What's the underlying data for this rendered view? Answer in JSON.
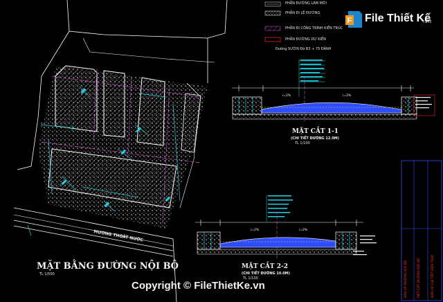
{
  "legend": {
    "items": [
      {
        "label": "PHẦN ĐƯỜNG LÀM MỚI",
        "swatch": "lines"
      },
      {
        "label": "PHẦN ĐI LÊ ĐƯỜNG",
        "swatch": "dots"
      },
      {
        "label": "PHẦN ĐI CÔNG TRÌNH KIẾN TRÚC",
        "swatch": "hatch"
      },
      {
        "label": "PHẦN ĐƯỜNG DỰ KIẾN",
        "swatch": "box"
      }
    ],
    "note": "Đường SƯỜN Độ B3 + 75 ĐÁNH"
  },
  "plan": {
    "title": "MẶT BẰNG ĐƯỜNG NỘI BỘ",
    "scale": "TL 1/500",
    "road_label": "MƯƠNG THOÁT NƯỚC"
  },
  "section1": {
    "title": "MẶT CẮT 1-1",
    "subtitle": "(CHI TIẾT ĐƯỜNG 12.0M)",
    "scale": "TL 1/100",
    "slope_left": "i=2%",
    "slope_right": "i=2%"
  },
  "section2": {
    "title": "MẶT CẮT 2-2",
    "subtitle": "(CHI TIẾT ĐƯỜNG 10.0M)",
    "scale": "TL 1/100",
    "slope_left": "i=2%",
    "slope_right": "i=2%"
  },
  "title_block": {
    "col1": "BẢN VẼ ĐƯỜNG NỘI BỘ",
    "col2": "MẶT CẮT ĐƯỜNG NỘI BỘ",
    "col3": "BẢN VẼ CHI TIẾT KIẾN TRÚC"
  },
  "watermark": {
    "logo_text": "File Thiết Kế",
    "logo_domain": ".vn",
    "copyright": "Copyright © FileThietKe.vn"
  },
  "colors": {
    "background": "#000000",
    "cyan": "#19d6e6",
    "magenta": "#d44fd4",
    "white": "#ffffff",
    "red": "#ff2a2a",
    "yellow": "#e8d84a",
    "blue": "#2d4dff",
    "logo_orange": "#f39a1b",
    "logo_blue": "#1a86d0"
  }
}
